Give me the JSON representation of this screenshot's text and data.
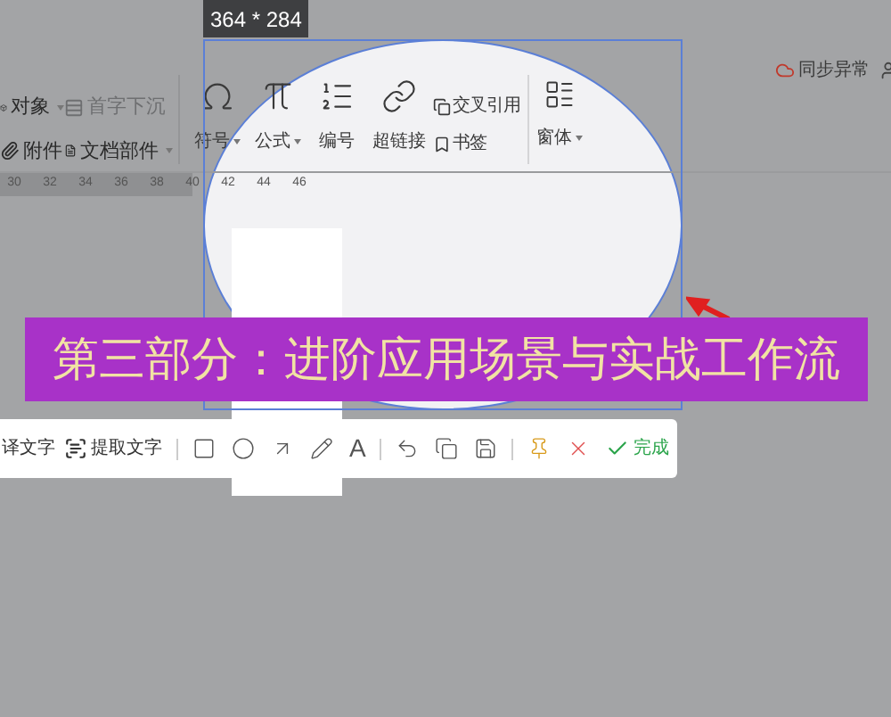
{
  "size_label": "364 * 284",
  "ribbon": {
    "small_items": [
      {
        "label": "对象",
        "dropdown": true,
        "disabled": false
      },
      {
        "label": "首字下沉",
        "dropdown": false,
        "disabled": true
      },
      {
        "label": "附件",
        "dropdown": false,
        "disabled": false
      },
      {
        "label": "文档部件",
        "dropdown": true,
        "disabled": false
      }
    ],
    "big_items": [
      {
        "label": "符号",
        "dropdown": true
      },
      {
        "label": "公式",
        "dropdown": true
      },
      {
        "label": "编号",
        "dropdown": false
      },
      {
        "label": "超链接",
        "dropdown": false
      }
    ],
    "stack_items": [
      "交叉引用",
      "书签"
    ],
    "form": {
      "label": "窗体",
      "dropdown": true
    }
  },
  "sync_status": "同步异常",
  "ruler": [
    "30",
    "32",
    "34",
    "36",
    "38",
    "40",
    "42",
    "44",
    "46"
  ],
  "banner": "第三部分：进阶应用场景与实战工作流",
  "annotation_toolbar": {
    "text_tools": [
      "译文字",
      "提取文字"
    ],
    "text_glyph": "A",
    "done": "完成"
  }
}
